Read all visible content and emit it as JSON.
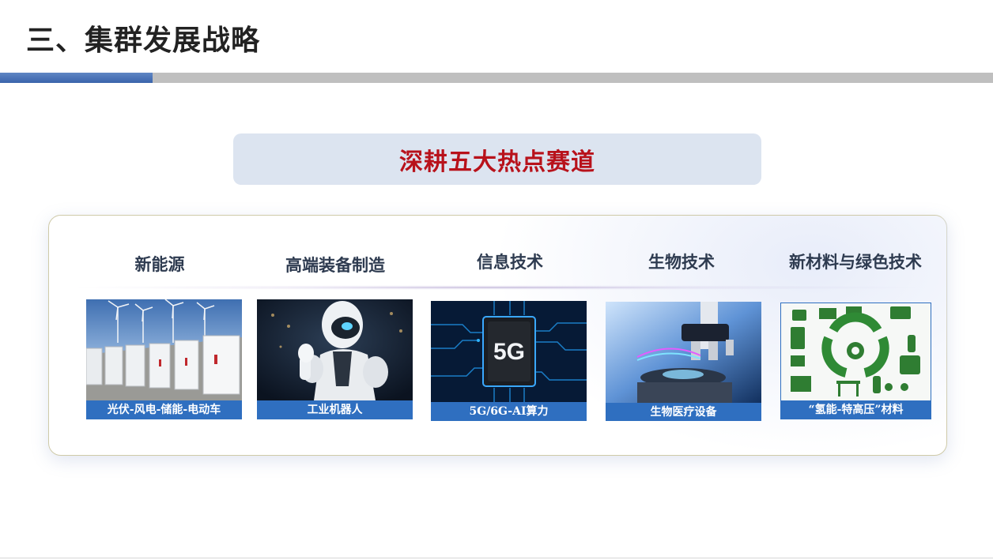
{
  "slide": {
    "title": "三、集群发展战略"
  },
  "banner": {
    "text": "深耕五大热点赛道"
  },
  "tracks": [
    {
      "heading": "新能源",
      "caption": "光伏-风电-储能-电动车",
      "icon": "solar-wind-storage-image"
    },
    {
      "heading": "高端装备制造",
      "caption": "工业机器人",
      "icon": "robot-image"
    },
    {
      "heading": "信息技术",
      "caption": "5G/6G-AI算力",
      "icon": "5g-chip-image",
      "chip_label": "5G"
    },
    {
      "heading": "生物技术",
      "caption": "生物医疗设备",
      "icon": "microscope-image"
    },
    {
      "heading": "新材料与绿色技术",
      "caption": "“氢能-特高压”材料",
      "icon": "recycle-image"
    }
  ],
  "colors": {
    "accent_blue": "#2f6fc0",
    "title_red": "#b8121b",
    "banner_bg": "#dce4f0"
  }
}
